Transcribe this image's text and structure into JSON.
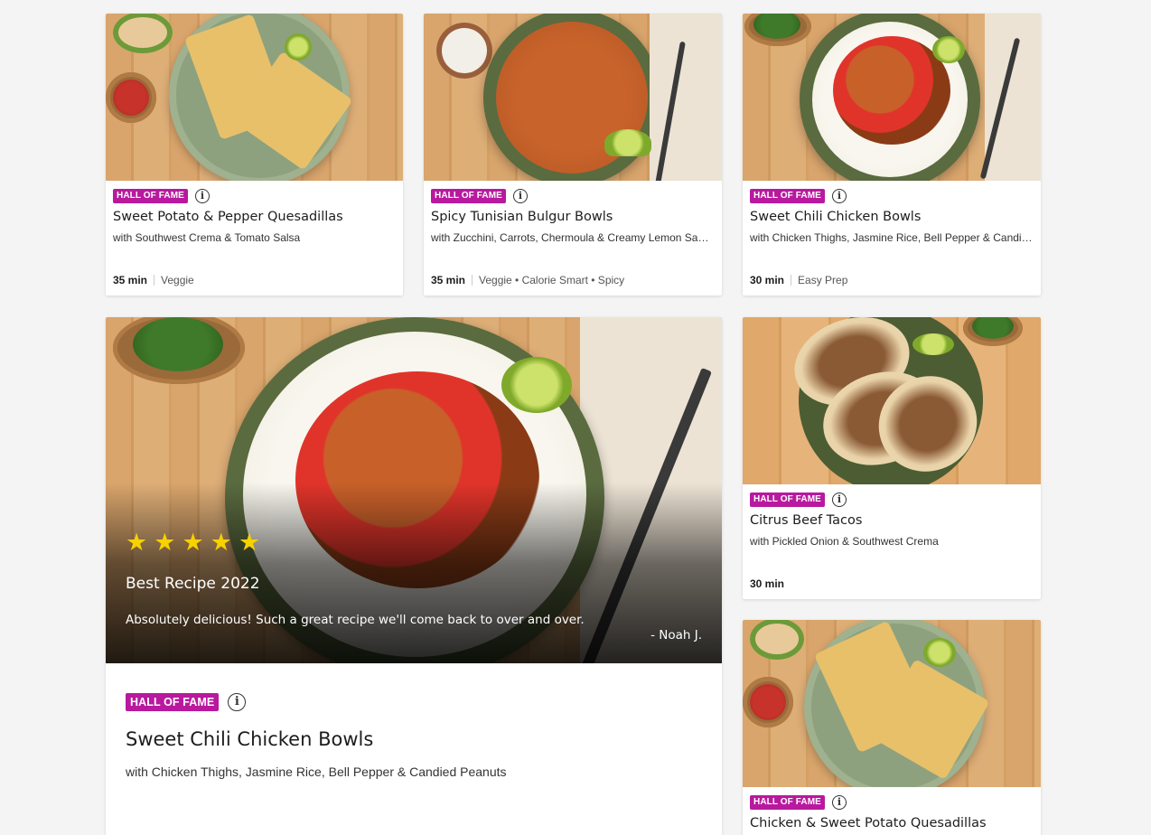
{
  "cards": [
    {
      "badge": "HALL OF FAME",
      "title": "Sweet Potato & Pepper Quesadillas",
      "subtitle": "with Southwest Crema & Tomato Salsa",
      "time": "35 min",
      "tags": "Veggie"
    },
    {
      "badge": "HALL OF FAME",
      "title": "Spicy Tunisian Bulgur Bowls",
      "subtitle": "with Zucchini, Carrots, Chermoula & Creamy Lemon Sa…",
      "time": "35 min",
      "tags": "Veggie • Calorie Smart • Spicy"
    },
    {
      "badge": "HALL OF FAME",
      "title": "Sweet Chili Chicken Bowls",
      "subtitle": "with Chicken Thighs, Jasmine Rice, Bell Pepper & Candi…",
      "time": "30 min",
      "tags": "Easy Prep"
    },
    {
      "badge": "HALL OF FAME",
      "title": "Citrus Beef Tacos",
      "subtitle": "with Pickled Onion & Southwest Crema",
      "time": "30 min",
      "tags": ""
    },
    {
      "badge": "HALL OF FAME",
      "title": "Chicken & Sweet Potato Quesadillas",
      "subtitle": "",
      "time": "",
      "tags": ""
    }
  ],
  "featured": {
    "rating": 5,
    "stars": [
      "★",
      "★",
      "★",
      "★",
      "★"
    ],
    "award": "Best Recipe 2022",
    "quote": "Absolutely delicious! Such a great recipe we'll come back to over and over.",
    "author": "- Noah J.",
    "badge": "HALL OF FAME",
    "title": "Sweet Chili Chicken Bowls",
    "subtitle": "with Chicken Thighs, Jasmine Rice, Bell Pepper & Candied Peanuts"
  },
  "icons": {
    "info": "i"
  },
  "colors": {
    "badge": "#b8199e",
    "star": "#f7d100",
    "background": "#f4f4f4"
  }
}
